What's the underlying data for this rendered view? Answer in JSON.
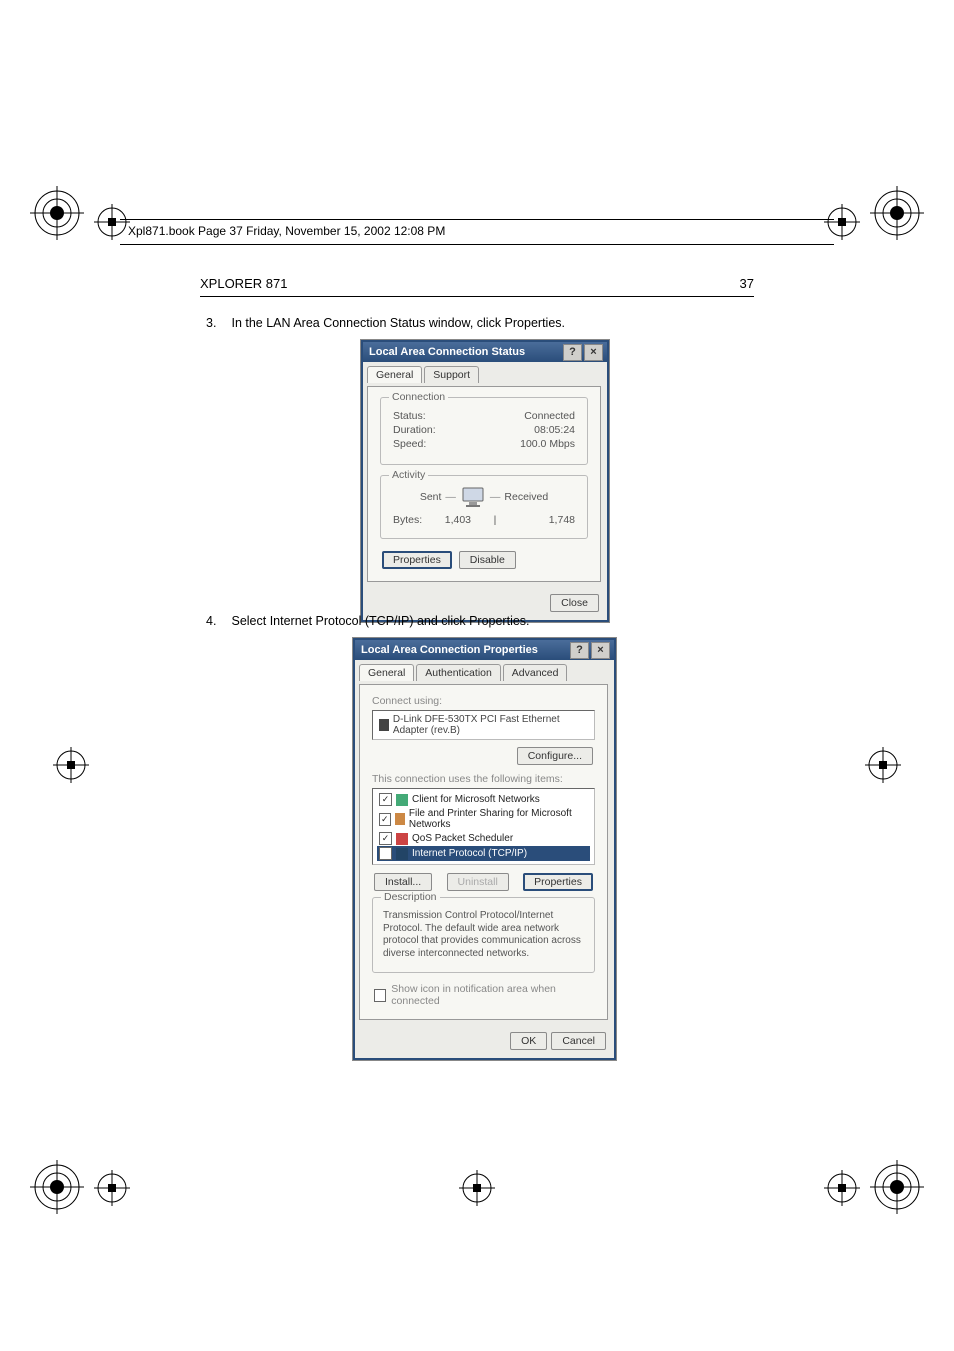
{
  "header_ruler_text": "Xpl871.book  Page 37  Friday, November 15, 2002  12:08 PM",
  "page_header": "XPLORER 871",
  "page_number": "37",
  "step3": {
    "num": "3.",
    "text": "In the LAN Area Connection Status window, click Properties."
  },
  "step4": {
    "num": "4.",
    "text": "Select Internet Protocol (TCP/IP) and click Properties."
  },
  "dlg1": {
    "title": "Local Area Connection Status",
    "help": "?",
    "close": "×",
    "tabs": {
      "general": "General",
      "support": "Support"
    },
    "connection_group": "Connection",
    "status_label": "Status:",
    "status_value": "Connected",
    "duration_label": "Duration:",
    "duration_value": "08:05:24",
    "speed_label": "Speed:",
    "speed_value": "100.0 Mbps",
    "activity_group": "Activity",
    "sent_label": "Sent",
    "received_label": "Received",
    "dash": "—",
    "bytes_label": "Bytes:",
    "bytes_sent": "1,403",
    "bytes_recv": "1,748",
    "properties_btn": "Properties",
    "disable_btn": "Disable",
    "close_btn": "Close"
  },
  "dlg2": {
    "title": "Local Area Connection Properties",
    "help": "?",
    "close": "×",
    "tabs": {
      "general": "General",
      "auth": "Authentication",
      "adv": "Advanced"
    },
    "connect_using_label": "Connect using:",
    "adapter": "D-Link DFE-530TX PCI Fast Ethernet Adapter (rev.B)",
    "configure_btn": "Configure...",
    "uses_items_label": "This connection uses the following items:",
    "item_client": "Client for Microsoft Networks",
    "item_fps": "File and Printer Sharing for Microsoft Networks",
    "item_qos": "QoS Packet Scheduler",
    "item_tcpip": "Internet Protocol (TCP/IP)",
    "install_btn": "Install...",
    "uninstall_btn": "Uninstall",
    "properties_btn": "Properties",
    "desc_label": "Description",
    "desc_text": "Transmission Control Protocol/Internet Protocol. The default wide area network protocol that provides communication across diverse interconnected networks.",
    "show_icon_label": "Show icon in notification area when connected",
    "ok_btn": "OK",
    "cancel_btn": "Cancel"
  }
}
